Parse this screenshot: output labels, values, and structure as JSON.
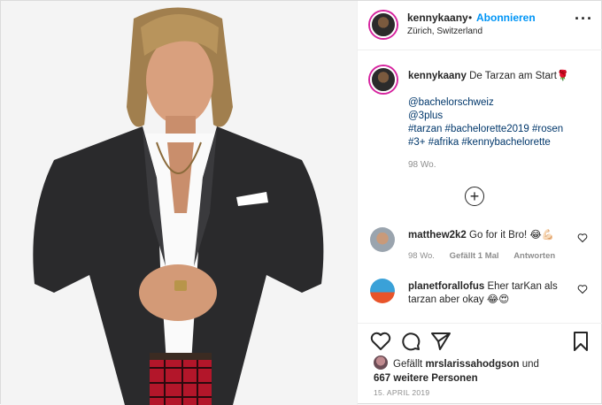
{
  "header": {
    "username": "kennykaany",
    "separator": "•",
    "follow_label": "Abonnieren",
    "location": "Zürich, Switzerland",
    "more_icon": "more-icon"
  },
  "caption": {
    "username": "kennykaany",
    "text": "De Tarzan am Start🌹",
    "mentions": [
      "@bachelorschweiz",
      "@3plus"
    ],
    "hashtags_line1": "#tarzan #bachelorette2019 #rosen",
    "hashtags_line2": "#3+ #afrika #kennybachelorette",
    "age": "98 Wo."
  },
  "load_more_icon": "plus-circle-icon",
  "comments": [
    {
      "username": "matthew2k2",
      "text": "Go for it Bro! 😂💪🏻",
      "age": "98 Wo.",
      "likes": "Gefällt 1 Mal",
      "reply": "Antworten"
    },
    {
      "username": "planetforallofus",
      "text": "Eher tarKan als tarzan aber okay 😂😍"
    }
  ],
  "liked_by": {
    "prefix": "Gefällt",
    "user": "mrslarissahodgson",
    "joiner": "und",
    "others": "667 weitere Personen"
  },
  "date": "15. APRIL 2019",
  "colors": {
    "link": "#00376b",
    "follow": "#0095f6",
    "muted": "#8e8e8e",
    "border": "#efefef"
  }
}
